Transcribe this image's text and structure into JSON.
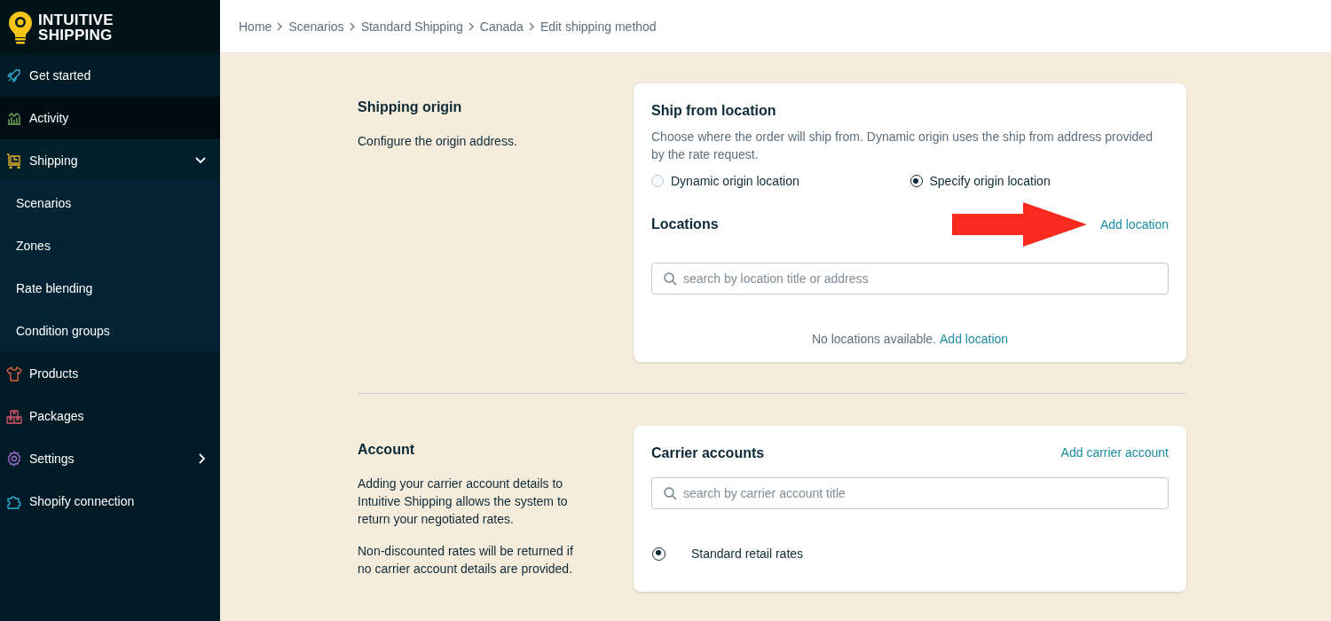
{
  "brand": {
    "line1": "INTUITIVE",
    "line2": "SHIPPING"
  },
  "sidebar": {
    "items": [
      {
        "label": "Get started",
        "selected": false
      },
      {
        "label": "Activity",
        "selected": true
      },
      {
        "label": "Shipping",
        "selected": false,
        "expanded": true,
        "children": [
          {
            "label": "Scenarios",
            "selected": false
          },
          {
            "label": "Zones",
            "selected": false
          },
          {
            "label": "Rate blending",
            "selected": false
          },
          {
            "label": "Condition groups",
            "selected": false
          }
        ]
      },
      {
        "label": "Products",
        "selected": false
      },
      {
        "label": "Packages",
        "selected": false
      },
      {
        "label": "Settings",
        "selected": false,
        "expanded": false
      },
      {
        "label": "Shopify connection",
        "selected": false
      }
    ]
  },
  "breadcrumb": [
    "Home",
    "Scenarios",
    "Standard Shipping",
    "Canada",
    "Edit shipping method"
  ],
  "sections": [
    {
      "title": "Shipping origin",
      "descriptions": [
        "Configure the origin address."
      ],
      "card": {
        "title": "Ship from location",
        "description": "Choose where the order will ship from. Dynamic origin uses the ship from address provided by the rate request.",
        "options": [
          {
            "label": "Dynamic origin location",
            "selected": false
          },
          {
            "label": "Specify origin location",
            "selected": true
          }
        ],
        "subtitle": "Locations",
        "action": "Add location",
        "annotation_arrow": true,
        "search": {
          "placeholder": "search by location title or address"
        },
        "empty": {
          "text": "No locations available.",
          "link": "Add location"
        }
      }
    },
    {
      "title": "Account",
      "descriptions": [
        "Adding your carrier account details to Intuitive Shipping allows the system to return your negotiated rates.",
        "Non-discounted rates will be returned if no carrier account details are provided."
      ],
      "card": {
        "title": "Carrier accounts",
        "action": "Add carrier account",
        "search": {
          "placeholder": "search by carrier account title"
        },
        "rates": [
          {
            "label": "Standard retail rates",
            "selected": true
          }
        ]
      }
    }
  ]
}
